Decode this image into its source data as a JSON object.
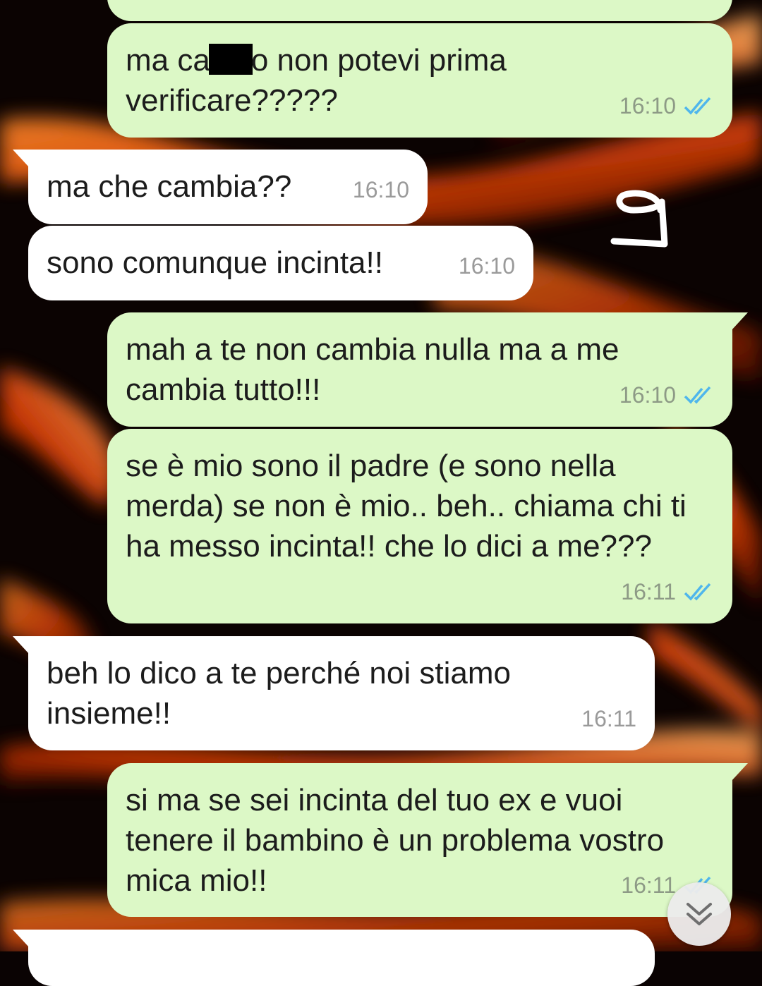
{
  "chat": {
    "messages": [
      {
        "direction": "outgoing",
        "text_before": "ma ca",
        "text_after": "o non potevi prima verificare?????",
        "time": "16:10",
        "status": "read"
      },
      {
        "direction": "incoming",
        "text": "ma che cambia??",
        "time": "16:10"
      },
      {
        "direction": "incoming",
        "text": "sono comunque incinta!!",
        "time": "16:10"
      },
      {
        "direction": "outgoing",
        "text": "mah a te non cambia nulla ma a me cambia tutto!!!",
        "time": "16:10",
        "status": "read"
      },
      {
        "direction": "outgoing",
        "text": "se è mio sono il padre (e sono nella merda) se non è mio.. beh.. chiama chi ti ha messo incinta!! che lo dici a me???",
        "time": "16:11",
        "status": "read"
      },
      {
        "direction": "incoming",
        "text": "beh lo dico a te perché noi stiamo insieme!!",
        "time": "16:11"
      },
      {
        "direction": "outgoing",
        "text": "si ma se sei incinta del tuo ex e vuoi tenere il bambino è un problema vostro mica mio!!",
        "time": "16:11",
        "status": "read"
      }
    ]
  },
  "annotation": {
    "handwritten_number": "9"
  },
  "colors": {
    "outgoing_bubble": "#dcf8c6",
    "incoming_bubble": "#ffffff",
    "read_ticks": "#4fb6ec",
    "background_flame": "#ff5a10"
  },
  "icons": {
    "scroll_down": "double-chevron-down-icon",
    "read_receipt": "double-check-icon"
  }
}
